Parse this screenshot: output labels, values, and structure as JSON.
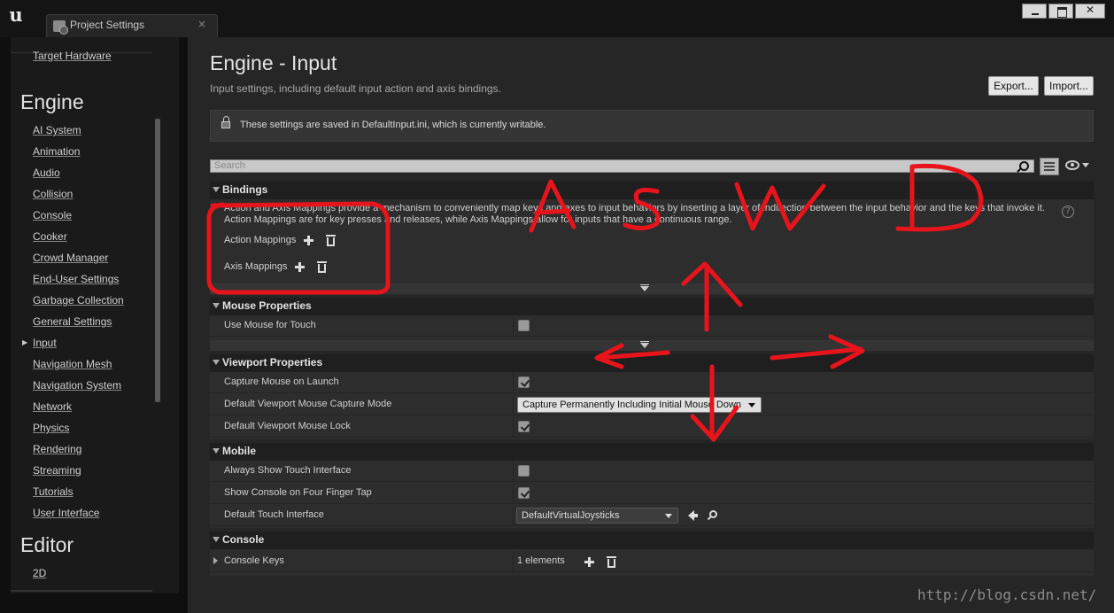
{
  "window": {
    "tab_title": "Project Settings",
    "tab_close": "×"
  },
  "sidebar": {
    "top_item": "Target Hardware",
    "engine_heading": "Engine",
    "items": [
      "AI System",
      "Animation",
      "Audio",
      "Collision",
      "Console",
      "Cooker",
      "Crowd Manager",
      "End-User Settings",
      "Garbage Collection",
      "General Settings",
      "Input",
      "Navigation Mesh",
      "Navigation System",
      "Network",
      "Physics",
      "Rendering",
      "Streaming",
      "Tutorials",
      "User Interface"
    ],
    "selected": "Input",
    "editor_heading": "Editor",
    "editor_items": [
      "2D"
    ]
  },
  "main": {
    "title": "Engine - Input",
    "subtitle": "Input settings, including default input action and axis bindings.",
    "export_label": "Export...",
    "import_label": "Import...",
    "notice": "These settings are saved in DefaultInput.ini, which is currently writable.",
    "search_placeholder": "Search",
    "sections": {
      "bindings": {
        "title": "Bindings",
        "description": "Action and Axis Mappings provide a mechanism to conveniently map keys and axes to input behaviors by inserting a layer of indirection between the input behavior and the keys that invoke it. Action Mappings are for key presses and releases, while Axis Mappings allow for inputs that have a continuous range.",
        "help": "?",
        "action_mappings": "Action Mappings",
        "axis_mappings": "Axis Mappings"
      },
      "mouse": {
        "title": "Mouse Properties",
        "use_mouse_for_touch": "Use Mouse for Touch"
      },
      "viewport": {
        "title": "Viewport Properties",
        "capture_mouse_on_launch": "Capture Mouse on Launch",
        "capture_mode_label": "Default Viewport Mouse Capture Mode",
        "capture_mode_value": "Capture Permanently Including Initial Mouse Down",
        "mouse_lock": "Default Viewport Mouse Lock"
      },
      "mobile": {
        "title": "Mobile",
        "always_show_touch": "Always Show Touch Interface",
        "show_console_four_finger": "Show Console on Four Finger Tap",
        "default_touch_interface": "Default Touch Interface",
        "default_touch_interface_value": "DefaultVirtualJoysticks"
      },
      "console": {
        "title": "Console",
        "console_keys": "Console Keys",
        "console_keys_value": "1 elements"
      }
    }
  },
  "annotations": {
    "letters": [
      "A",
      "S",
      "W",
      "D"
    ],
    "color": "#e8141c"
  },
  "watermark": "http://blog.csdn.net/"
}
